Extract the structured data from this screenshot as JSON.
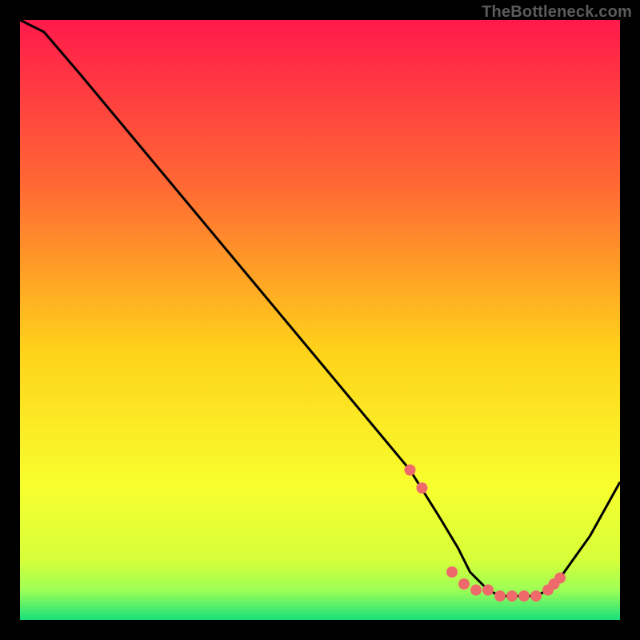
{
  "watermark": "TheBottleneck.com",
  "colors": {
    "curve": "#000000",
    "markers": "#ee6a6a",
    "gradient": {
      "top": "#ff1a4b",
      "q1": "#ff6a33",
      "mid": "#ffd21a",
      "q3": "#f7ff2e",
      "band1": "#d6ff3a",
      "band2": "#9dff55",
      "bottom": "#18e07c"
    }
  },
  "chart_data": {
    "type": "line",
    "title": "",
    "xlabel": "",
    "ylabel": "",
    "xlim": [
      0,
      100
    ],
    "ylim": [
      0,
      100
    ],
    "series": [
      {
        "name": "bottleneck-curve",
        "x": [
          0,
          4,
          10,
          20,
          30,
          40,
          50,
          60,
          65,
          70,
          73,
          75,
          78,
          80,
          82,
          84,
          86,
          88,
          90,
          95,
          100
        ],
        "values": [
          100,
          98,
          91,
          79,
          67,
          55,
          43,
          31,
          25,
          17,
          12,
          8,
          5,
          4,
          4,
          4,
          4,
          5,
          7,
          14,
          23
        ]
      }
    ],
    "markers": {
      "name": "highlighted-points",
      "x": [
        65,
        67,
        72,
        74,
        76,
        78,
        80,
        82,
        84,
        86,
        88,
        89,
        90
      ],
      "values": [
        25,
        22,
        8,
        6,
        5,
        5,
        4,
        4,
        4,
        4,
        5,
        6,
        7
      ]
    }
  }
}
